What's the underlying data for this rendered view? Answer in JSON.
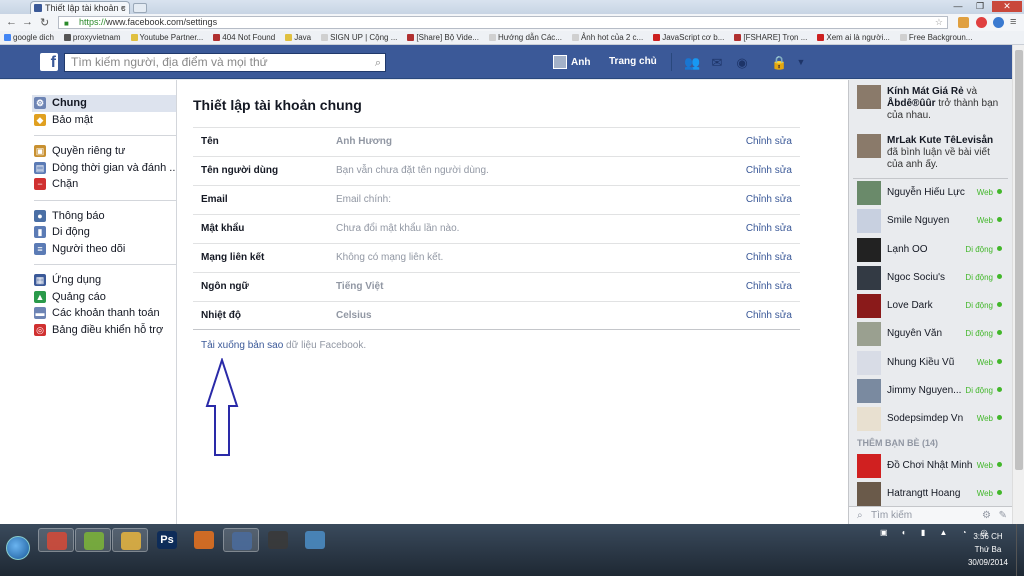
{
  "browser": {
    "tab_title": "Thiết lập tài khoản c",
    "url_scheme": "https://",
    "url_rest": "www.facebook.com/settings",
    "bookmarks": [
      {
        "label": "google dich",
        "color": "#4285f4"
      },
      {
        "label": "proxyvietnam",
        "color": "#555555"
      },
      {
        "label": "Youtube Partner...",
        "color": "#e0c040"
      },
      {
        "label": "404 Not Found",
        "color": "#b03030"
      },
      {
        "label": "Java",
        "color": "#e0c040"
      },
      {
        "label": "SIGN UP | Cộng ...",
        "color": "#d0d0d0"
      },
      {
        "label": "[Share] Bộ Vide...",
        "color": "#b03030"
      },
      {
        "label": "Hướng dẫn Các...",
        "color": "#d0d0d0"
      },
      {
        "label": "Ảnh hot của 2 c...",
        "color": "#d0d0d0"
      },
      {
        "label": "JavaScript cơ b...",
        "color": "#cc2020"
      },
      {
        "label": "[FSHARE] Trọn ...",
        "color": "#b03030"
      },
      {
        "label": "Xem ai là người...",
        "color": "#cc2020"
      },
      {
        "label": "Free Backgroun...",
        "color": "#d0d0d0"
      }
    ]
  },
  "header": {
    "logo": "f",
    "search_placeholder": "Tìm kiếm người, địa điểm và mọi thứ",
    "profile_name": "Anh",
    "home_label": "Trang chủ"
  },
  "leftnav": {
    "group1": [
      {
        "label": "Chung",
        "icon": "gear-icon",
        "color": "#6d84b4",
        "glyph": "⚙"
      },
      {
        "label": "Bảo mật",
        "icon": "shield-icon",
        "color": "#e0a020",
        "glyph": "◆"
      }
    ],
    "group2": [
      {
        "label": "Quyền riêng tư",
        "icon": "lock-icon",
        "color": "#c89030",
        "glyph": "▣"
      },
      {
        "label": "Dòng thời gian và đánh ...",
        "icon": "timeline-icon",
        "color": "#5b7bb5",
        "glyph": "▤"
      },
      {
        "label": "Chặn",
        "icon": "block-icon",
        "color": "#d03030",
        "glyph": "−"
      }
    ],
    "group3": [
      {
        "label": "Thông báo",
        "icon": "globe-icon",
        "color": "#4a6fa5",
        "glyph": "●"
      },
      {
        "label": "Di động",
        "icon": "mobile-icon",
        "color": "#5b7bb5",
        "glyph": "▮"
      },
      {
        "label": "Người theo dõi",
        "icon": "rss-icon",
        "color": "#5b7bb5",
        "glyph": "≡"
      }
    ],
    "group4": [
      {
        "label": "Ứng dụng",
        "icon": "apps-icon",
        "color": "#3b5998",
        "glyph": "▦"
      },
      {
        "label": "Quảng cáo",
        "icon": "ads-icon",
        "color": "#2a9a4a",
        "glyph": "▲"
      },
      {
        "label": "Các khoản thanh toán",
        "icon": "credit-card-icon",
        "color": "#6d84b4",
        "glyph": "▬"
      },
      {
        "label": "Bảng điều khiển hỗ trợ",
        "icon": "lifebuoy-icon",
        "color": "#d03030",
        "glyph": "◎"
      }
    ]
  },
  "settings": {
    "title": "Thiết lập tài khoản chung",
    "edit_label": "Chỉnh sửa",
    "rows": [
      {
        "key": "Tên",
        "value": "Anh Hương",
        "bold": true
      },
      {
        "key": "Tên người dùng",
        "value": "Bạn vẫn chưa đặt tên người dùng.",
        "bold": false
      },
      {
        "key": "Email",
        "value": "Email chính:",
        "bold": false
      },
      {
        "key": "Mật khẩu",
        "value": "Chưa đổi mật khẩu lần nào.",
        "bold": false
      },
      {
        "key": "Mạng liên kết",
        "value": "Không có mạng liên kết.",
        "bold": false
      },
      {
        "key": "Ngôn ngữ",
        "value": "Tiếng Việt",
        "bold": true
      },
      {
        "key": "Nhiệt độ",
        "value": "Celsius",
        "bold": true
      }
    ],
    "download_link": "Tải xuống bản sao",
    "download_rest": " dữ liệu Facebook."
  },
  "sidebar": {
    "ticker": [
      {
        "name": "Kính Mát Giá Rẻ",
        "mid": " và ",
        "name2": "Åbdê®ûûr",
        "rest": " trở thành bạn của nhau."
      },
      {
        "name": "MrLak Kute TêLevisån",
        "mid": "",
        "name2": "",
        "rest": " đã bình luận về bài viết của anh ấy."
      }
    ],
    "contacts": [
      {
        "name": "Nguyễn Hiếu Lực",
        "status": "Web",
        "color": "#6a8a6a"
      },
      {
        "name": "Smile Nguyen",
        "status": "Web",
        "color": "#c8d0e0"
      },
      {
        "name": "Lạnh OO",
        "status": "Di động",
        "color": "#222222"
      },
      {
        "name": "Ngoc Sociu's",
        "status": "Di động",
        "color": "#333a44"
      },
      {
        "name": "Love Dark",
        "status": "Di động",
        "color": "#8a1a1a"
      },
      {
        "name": "Nguyên Văn",
        "status": "Di động",
        "color": "#9aa090"
      },
      {
        "name": "Nhung Kiều Vũ",
        "status": "Web",
        "color": "#d8dce6"
      },
      {
        "name": "Jimmy Nguyen...",
        "status": "Di động",
        "color": "#7a8aa0"
      },
      {
        "name": "Sodepsimdep Vn",
        "status": "Web",
        "color": "#e8e0d0"
      }
    ],
    "add_friends_header": "THÊM BẠN BÈ (14)",
    "suggestions": [
      {
        "name": "Đồ Chơi Nhật Minh",
        "status": "Web",
        "color": "#d02020"
      },
      {
        "name": "Hatrangtt Hoang",
        "status": "Web",
        "color": "#6a5a4a"
      }
    ],
    "search_label": "Tìm kiếm"
  },
  "taskbar": {
    "apps": [
      {
        "name": "chrome",
        "label": "",
        "color": "#d04a3a"
      },
      {
        "name": "utorrent",
        "label": "",
        "color": "#7ab03a"
      },
      {
        "name": "explorer",
        "label": "",
        "color": "#e0b040"
      },
      {
        "name": "photoshop",
        "label": "Ps",
        "color": "#0a2a5a"
      },
      {
        "name": "firefox",
        "label": "",
        "color": "#e07020"
      },
      {
        "name": "network",
        "label": "",
        "color": "#4a6a9a"
      },
      {
        "name": "screen",
        "label": "",
        "color": "#3a3a3a"
      },
      {
        "name": "paint",
        "label": "",
        "color": "#4a8ac0"
      }
    ],
    "time": "3:56 CH",
    "day": "Thứ Ba",
    "date": "30/09/2014"
  }
}
